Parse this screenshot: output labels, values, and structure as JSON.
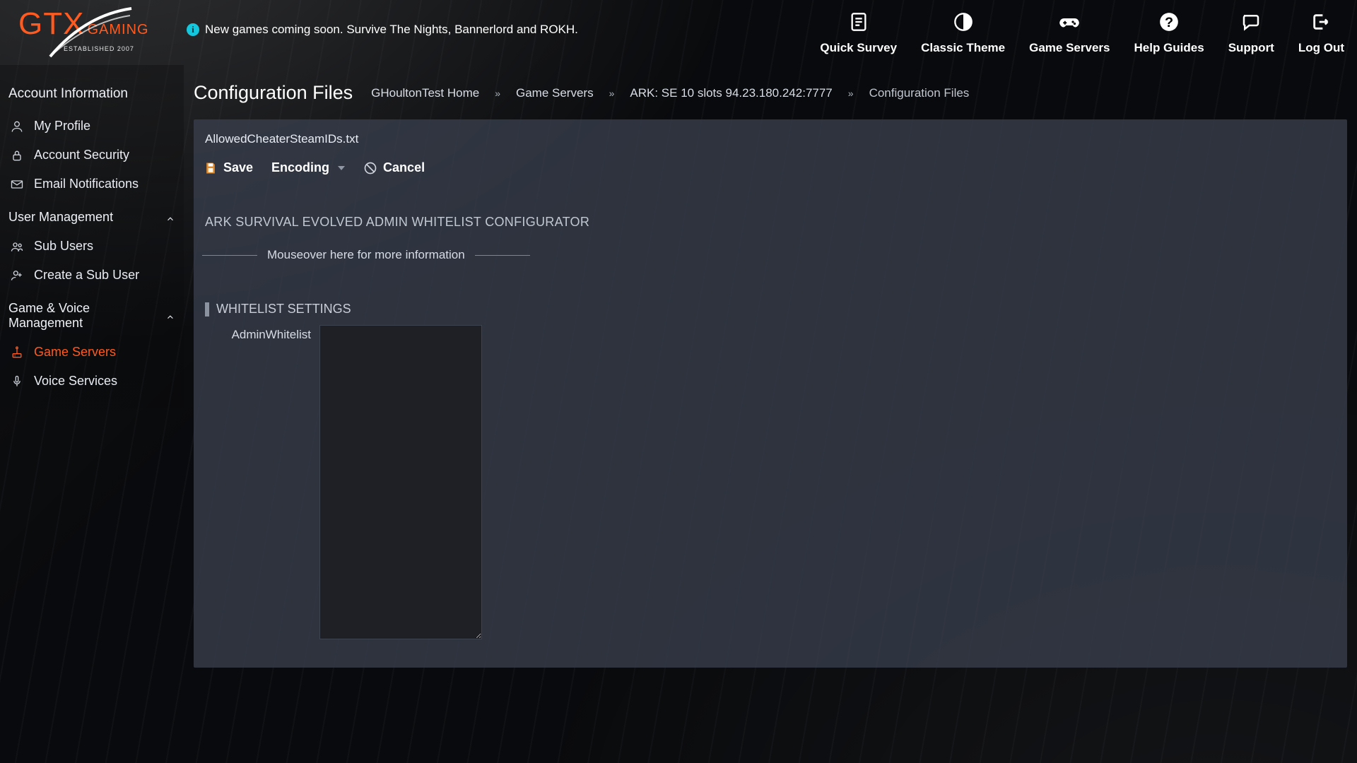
{
  "brand": {
    "gtx": "GTX",
    "gaming": "GAMING",
    "est": "ESTABLISHED 2007"
  },
  "news": "New games coming soon. Survive The Nights, Bannerlord and ROKH.",
  "topnav": {
    "survey": "Quick Survey",
    "theme": "Classic Theme",
    "servers": "Game Servers",
    "help": "Help Guides",
    "support": "Support",
    "logout": "Log Out"
  },
  "sidebar": {
    "account_info": "Account Information",
    "items_account": [
      {
        "label": "My Profile"
      },
      {
        "label": "Account Security"
      },
      {
        "label": "Email Notifications"
      }
    ],
    "user_mgmt": "User Management",
    "items_user": [
      {
        "label": "Sub Users"
      },
      {
        "label": "Create a Sub User"
      }
    ],
    "game_mgmt": "Game & Voice Management",
    "items_game": [
      {
        "label": "Game Servers"
      },
      {
        "label": "Voice Services"
      }
    ]
  },
  "page": {
    "title": "Configuration Files",
    "crumbs": {
      "home": "GHoultonTest Home",
      "servers": "Game Servers",
      "server": "ARK: SE 10 slots 94.23.180.242:7777",
      "current": "Configuration Files"
    }
  },
  "editor": {
    "filename": "AllowedCheaterSteamIDs.txt",
    "save": "Save",
    "encoding": "Encoding",
    "cancel": "Cancel",
    "cfg_title": "ARK SURVIVAL EVOLVED ADMIN WHITELIST CONFIGURATOR",
    "hint": "Mouseover here for more information",
    "section": "WHITELIST SETTINGS",
    "field_label": "AdminWhitelist",
    "field_value": ""
  }
}
